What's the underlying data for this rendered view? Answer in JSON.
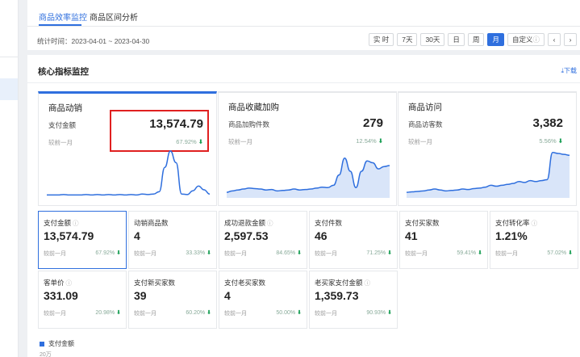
{
  "tabs": [
    {
      "label": "商品效率监控",
      "active": true
    },
    {
      "label": "商品区间分析",
      "active": false
    }
  ],
  "period": {
    "label": "统计时间",
    "range": "2023-04-01 ~ 2023-04-30"
  },
  "period_buttons": [
    "实 时",
    "7天",
    "30天",
    "日",
    "周",
    "月",
    "自定义"
  ],
  "active_period": "月",
  "section": {
    "title": "核心指标监控",
    "download": "下载"
  },
  "accent_color": "#2f6fde",
  "big_cards": [
    {
      "title": "商品动销",
      "label": "支付金额",
      "value": "13,574.79",
      "compare": "较前一月",
      "pct": "67.92%",
      "trend": [
        0.01,
        0.01,
        0.01,
        0.02,
        0.01,
        0.01,
        0.01,
        0.02,
        0.01,
        0.02,
        0.01,
        0.02,
        0.01,
        0.02,
        0.01,
        0.02,
        0.01,
        0.03,
        0.02,
        0.03,
        0.08,
        0.6,
        0.95,
        0.7,
        0.03,
        0.02,
        0.1,
        0.2,
        0.12,
        0.03
      ]
    },
    {
      "title": "商品收藏加购",
      "label": "商品加购件数",
      "value": "279",
      "compare": "较前一月",
      "pct": "12.54%",
      "trend": [
        0.05,
        0.08,
        0.1,
        0.12,
        0.14,
        0.13,
        0.12,
        0.1,
        0.11,
        0.08,
        0.09,
        0.1,
        0.12,
        0.1,
        0.11,
        0.12,
        0.14,
        0.16,
        0.15,
        0.2,
        0.42,
        0.78,
        0.5,
        0.15,
        0.5,
        0.72,
        0.68,
        0.55,
        0.6,
        0.62
      ]
    },
    {
      "title": "商品访问",
      "label": "商品访客数",
      "value": "3,382",
      "compare": "较前一月",
      "pct": "5.56%",
      "trend": [
        0.05,
        0.06,
        0.07,
        0.08,
        0.1,
        0.12,
        0.1,
        0.08,
        0.09,
        0.1,
        0.12,
        0.11,
        0.13,
        0.14,
        0.16,
        0.2,
        0.18,
        0.2,
        0.22,
        0.24,
        0.28,
        0.26,
        0.3,
        0.28,
        0.3,
        0.32,
        0.9,
        0.88,
        0.86,
        0.84
      ]
    }
  ],
  "small_cards": [
    {
      "label": "支付金额",
      "help": true,
      "value": "13,574.79",
      "compare": "较前一月",
      "pct": "67.92%"
    },
    {
      "label": "动销商品数",
      "help": false,
      "value": "4",
      "compare": "较前一月",
      "pct": "33.33%"
    },
    {
      "label": "成功退款金额",
      "help": true,
      "value": "2,597.53",
      "compare": "较前一月",
      "pct": "84.65%"
    },
    {
      "label": "支付件数",
      "help": false,
      "value": "46",
      "compare": "较前一月",
      "pct": "71.25%"
    },
    {
      "label": "支付买家数",
      "help": false,
      "value": "41",
      "compare": "较前一月",
      "pct": "59.41%"
    },
    {
      "label": "支付转化率",
      "help": true,
      "value": "1.21%",
      "compare": "较前一月",
      "pct": "57.02%"
    },
    {
      "label": "客单价",
      "help": true,
      "value": "331.09",
      "compare": "较前一月",
      "pct": "20.98%"
    },
    {
      "label": "支付新买家数",
      "help": false,
      "value": "39",
      "compare": "较前一月",
      "pct": "60.20%"
    },
    {
      "label": "支付老买家数",
      "help": false,
      "value": "4",
      "compare": "较前一月",
      "pct": "50.00%"
    },
    {
      "label": "老买家支付金额",
      "help": true,
      "value": "1,359.73",
      "compare": "较前一月",
      "pct": "90.93%"
    }
  ],
  "bottom_chart": {
    "legend": "支付金额",
    "top_tick": "20万"
  }
}
